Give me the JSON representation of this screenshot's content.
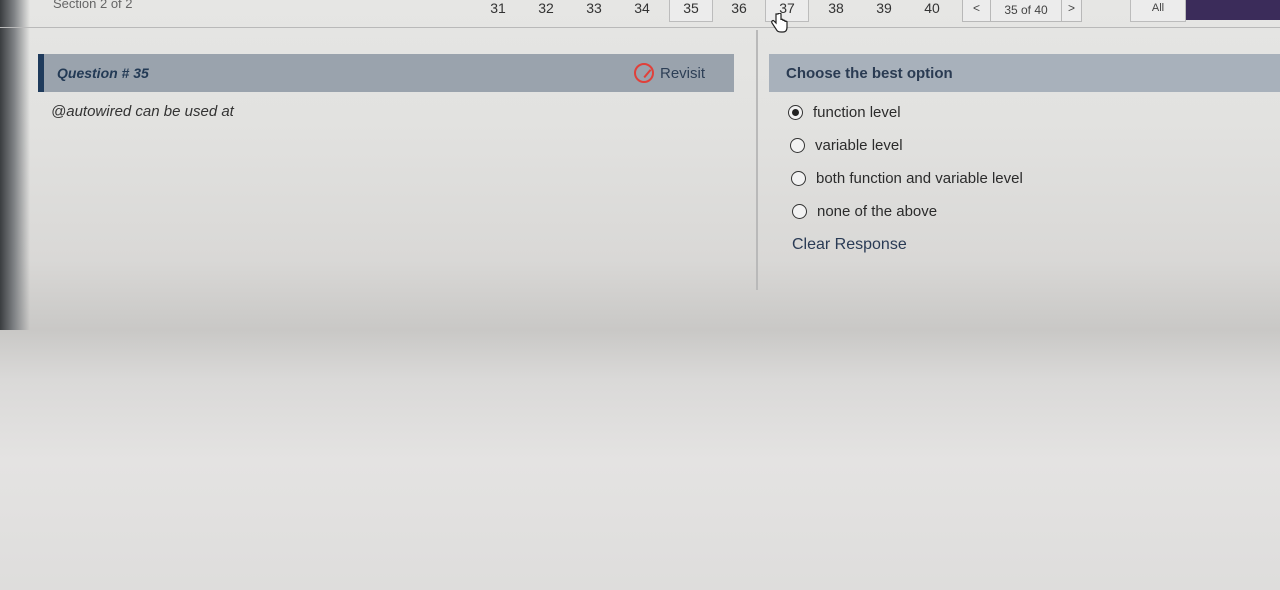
{
  "topbar": {
    "section": "Section 2 of 2",
    "questions": [
      "31",
      "32",
      "33",
      "34",
      "35",
      "36",
      "37",
      "38",
      "39",
      "40"
    ],
    "pager": {
      "prev": "<",
      "text": "35 of 40",
      "next": ">"
    },
    "all_label": "All"
  },
  "question": {
    "title": "Question # 35",
    "revisit_label": "Revisit",
    "text": "@autowired can be used at"
  },
  "answer": {
    "header": "Choose the best option",
    "options": [
      "function level",
      "variable level",
      "both function and variable level",
      "none of the above"
    ],
    "selected": "function level",
    "clear_label": "Clear Response"
  },
  "icons": {
    "revisit": "revisit-icon",
    "cursor": "hand-cursor-icon"
  },
  "colors": {
    "revisit_accent": "#e0403a",
    "question_header": "#9aa3ad",
    "option_header": "#a8b1bb"
  }
}
